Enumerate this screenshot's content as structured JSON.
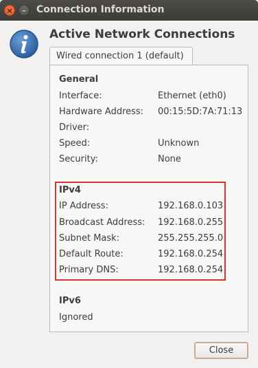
{
  "window": {
    "title": "Connection Information",
    "close_glyph": "×",
    "minimize_glyph": "–"
  },
  "header": {
    "icon": "info-icon",
    "heading": "Active Network Connections",
    "tab_label": "Wired connection 1 (default)"
  },
  "general": {
    "title": "General",
    "rows": [
      {
        "label": "Interface:",
        "value": "Ethernet (eth0)"
      },
      {
        "label": "Hardware Address:",
        "value": "00:15:5D:7A:71:13"
      },
      {
        "label": "Driver:",
        "value": ""
      },
      {
        "label": "Speed:",
        "value": "Unknown"
      },
      {
        "label": "Security:",
        "value": "None"
      }
    ]
  },
  "ipv4": {
    "title": "IPv4",
    "rows": [
      {
        "label": "IP Address:",
        "value": "192.168.0.103"
      },
      {
        "label": "Broadcast Address:",
        "value": "192.168.0.255"
      },
      {
        "label": "Subnet Mask:",
        "value": "255.255.255.0"
      },
      {
        "label": "Default Route:",
        "value": "192.168.0.254"
      },
      {
        "label": "Primary DNS:",
        "value": "192.168.0.254"
      }
    ]
  },
  "ipv6": {
    "title": "IPv6",
    "status": "Ignored"
  },
  "footer": {
    "close_label": "Close"
  },
  "colors": {
    "titlebar": "#3c3b37",
    "highlight_border": "#d9352c",
    "info_icon": "#3b74b8"
  }
}
